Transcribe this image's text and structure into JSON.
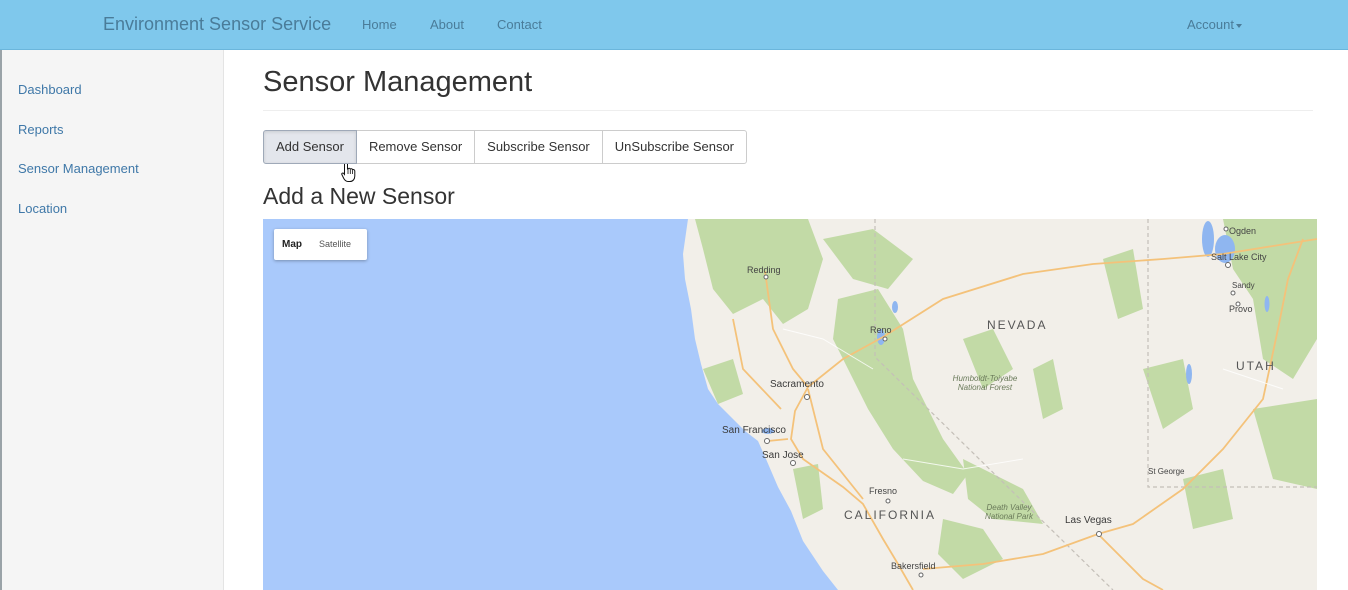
{
  "navbar": {
    "brand": "Environment Sensor Service",
    "links": [
      "Home",
      "About",
      "Contact"
    ],
    "account": "Account"
  },
  "sidebar": {
    "items": [
      {
        "label": "Dashboard"
      },
      {
        "label": "Reports"
      },
      {
        "label": "Sensor Management"
      },
      {
        "label": "Location"
      }
    ]
  },
  "main": {
    "title": "Sensor Management",
    "buttons": [
      {
        "label": "Add Sensor",
        "active": true
      },
      {
        "label": "Remove Sensor"
      },
      {
        "label": "Subscribe Sensor"
      },
      {
        "label": "UnSubscribe Sensor"
      }
    ],
    "section_title": "Add a New Sensor"
  },
  "map": {
    "type_controls": {
      "map": "Map",
      "satellite": "Satellite"
    },
    "selected_type": "Map",
    "places": {
      "redding": "Redding",
      "reno": "Reno",
      "sacramento": "Sacramento",
      "san_francisco": "San Francisco",
      "san_jose": "San Jose",
      "fresno": "Fresno",
      "bakersfield": "Bakersfield",
      "las_vegas": "Las Vegas",
      "st_george": "St George",
      "ogden": "Ogden",
      "salt_lake_city": "Salt Lake City",
      "sandy": "Sandy",
      "provo": "Provo"
    },
    "states": {
      "nevada": "NEVADA",
      "utah": "UTAH",
      "california": "CALIFORNIA"
    },
    "parks": {
      "humboldt": "Humboldt-Toiyabe National Forest",
      "death_valley": "Death Valley National Park"
    },
    "colors": {
      "ocean": "#a9c9fb",
      "land": "#f2efe9",
      "forest": "#c2daa6",
      "road": "#f4c27a",
      "lake": "#8fb6f0"
    }
  },
  "colors": {
    "navbar": "#7fc8ec",
    "link": "#3f78a8",
    "sidebar": "#f5f5f5"
  }
}
